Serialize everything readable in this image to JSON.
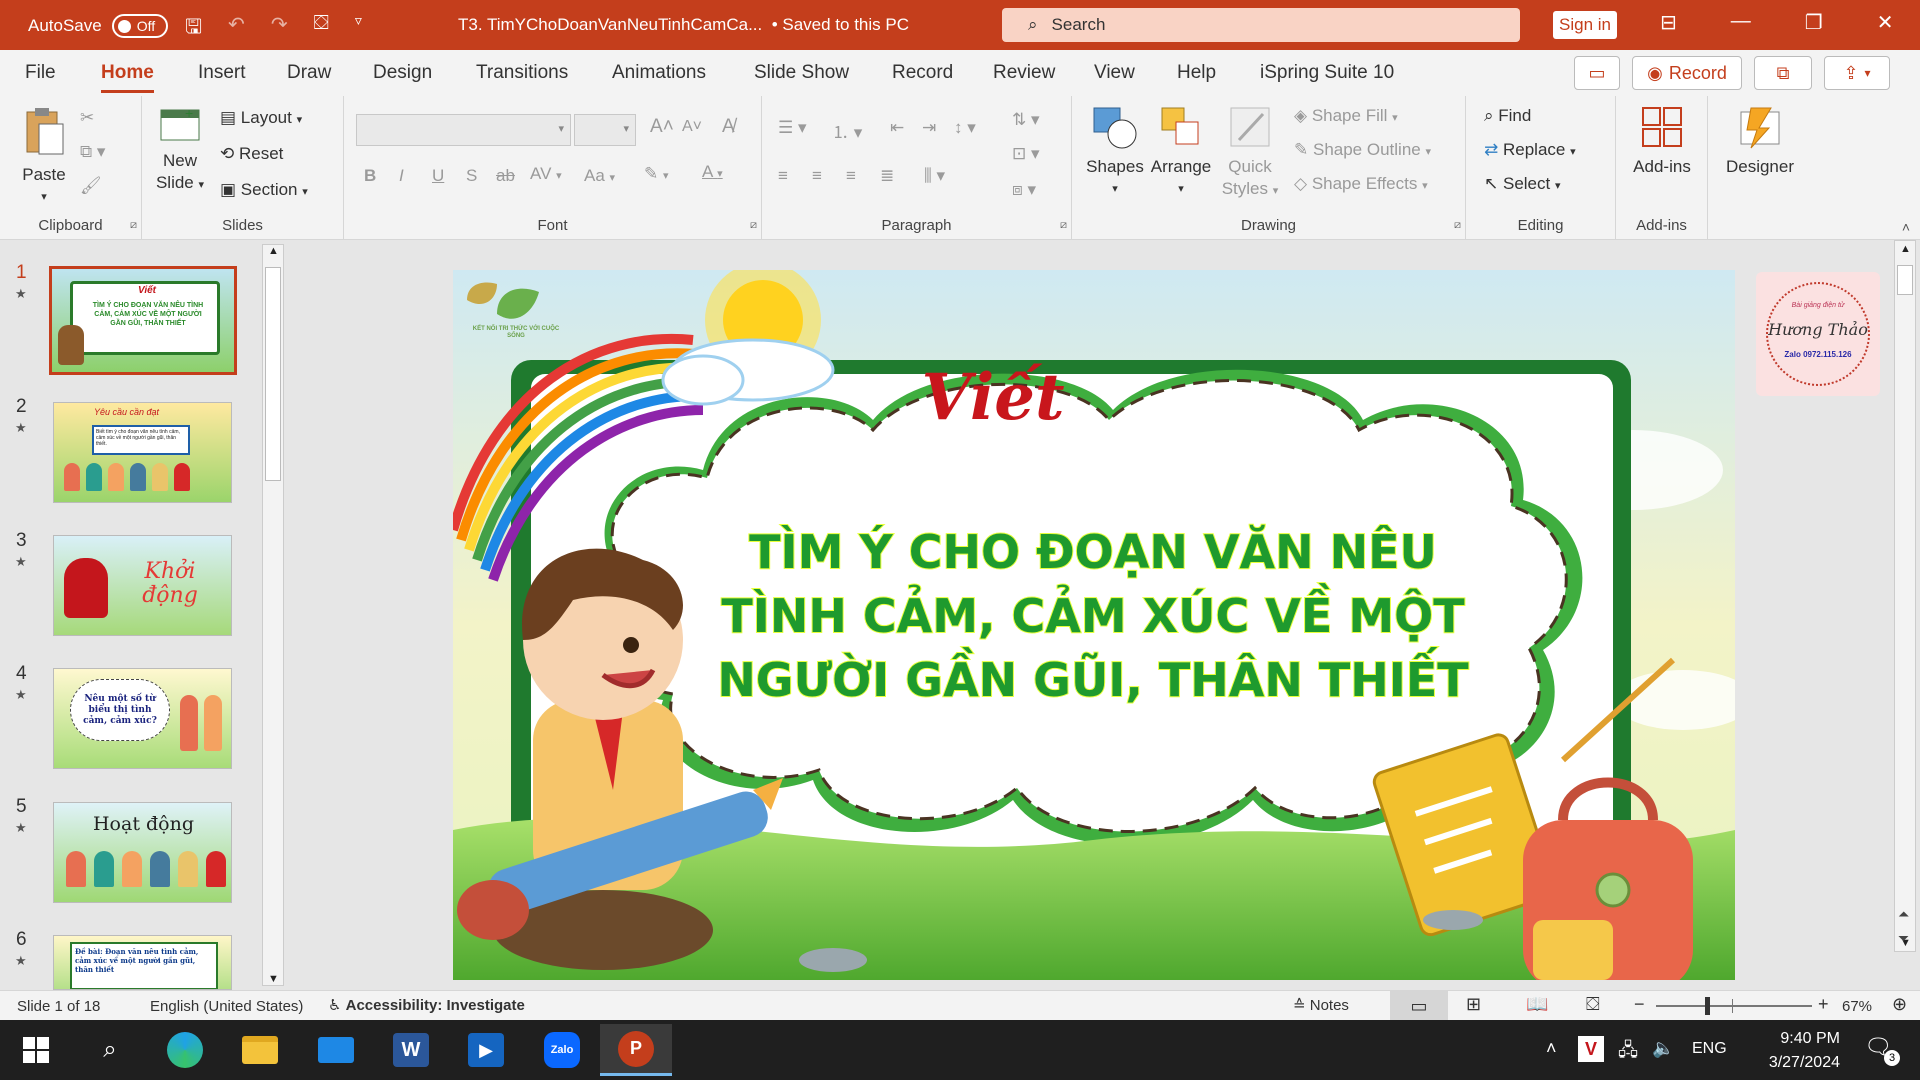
{
  "titlebar": {
    "autosave_label": "AutoSave",
    "autosave_state": "Off",
    "doc_title": "T3. TimYChoDoanVanNeuTinhCamCa...",
    "save_status": "• Saved to this PC",
    "search_placeholder": "Search",
    "signin": "Sign in"
  },
  "tabs": [
    "File",
    "Home",
    "Insert",
    "Draw",
    "Design",
    "Transitions",
    "Animations",
    "Slide Show",
    "Record",
    "Review",
    "View",
    "Help",
    "iSpring Suite 10"
  ],
  "tabs_right": {
    "record": "Record"
  },
  "ribbon": {
    "clipboard": {
      "paste": "Paste",
      "label": "Clipboard"
    },
    "slides": {
      "new_slide_1": "New",
      "new_slide_2": "Slide",
      "layout": "Layout",
      "reset": "Reset",
      "section": "Section",
      "label": "Slides"
    },
    "font": {
      "label": "Font",
      "bold": "B",
      "italic": "I",
      "underline": "U",
      "strike": "S",
      "abc": "ab",
      "spacing": "AV",
      "case": "Aa",
      "fontcolor": "A",
      "grow": "A",
      "shrink": "A"
    },
    "paragraph": {
      "label": "Paragraph"
    },
    "drawing": {
      "shapes": "Shapes",
      "arrange": "Arrange",
      "quick_1": "Quick",
      "quick_2": "Styles",
      "fill": "Shape Fill",
      "outline": "Shape Outline",
      "effects": "Shape Effects",
      "label": "Drawing"
    },
    "editing": {
      "find": "Find",
      "replace": "Replace",
      "select": "Select",
      "label": "Editing"
    },
    "addins": {
      "addins": "Add-ins",
      "label": "Add-ins"
    },
    "designer": {
      "designer": "Designer"
    }
  },
  "thumbnails": [
    {
      "num": "1",
      "text": "Viết"
    },
    {
      "num": "2",
      "text": "Yêu cầu cần đạt"
    },
    {
      "num": "3",
      "text": "Khởi động"
    },
    {
      "num": "4",
      "text": "Nêu một số từ biểu thị tình cảm, cảm xúc?"
    },
    {
      "num": "5",
      "text": "Hoạt động"
    },
    {
      "num": "6",
      "text": "Đề bài: Đoạn văn nêu tình cảm, cảm xúc về một người gần gũi, thân thiết"
    }
  ],
  "slide": {
    "logo_text": "KẾT NỐI TRI THỨC VỚI CUỘC SỐNG",
    "heading": "Viết",
    "title_lines": [
      "TÌM Ý CHO ĐOẠN VĂN NÊU",
      "TÌNH CẢM, CẢM XÚC VỀ MỘT",
      "NGƯỜI GẦN GŨI, THÂN THIẾT"
    ],
    "stamp_line1": "Bài giảng điện tử",
    "stamp_name": "Hương Thảo",
    "stamp_zalo": "Zalo 0972.115.126"
  },
  "statusbar": {
    "slide_info": "Slide 1 of 18",
    "language": "English (United States)",
    "accessibility": "Accessibility: Investigate",
    "notes": "Notes",
    "zoom": "67%",
    "zoom_level": 0.67
  },
  "taskbar": {
    "time": "9:40 PM",
    "date": "3/27/2024",
    "lang": "ENG",
    "zalo": "Zalo",
    "notif": "3"
  }
}
